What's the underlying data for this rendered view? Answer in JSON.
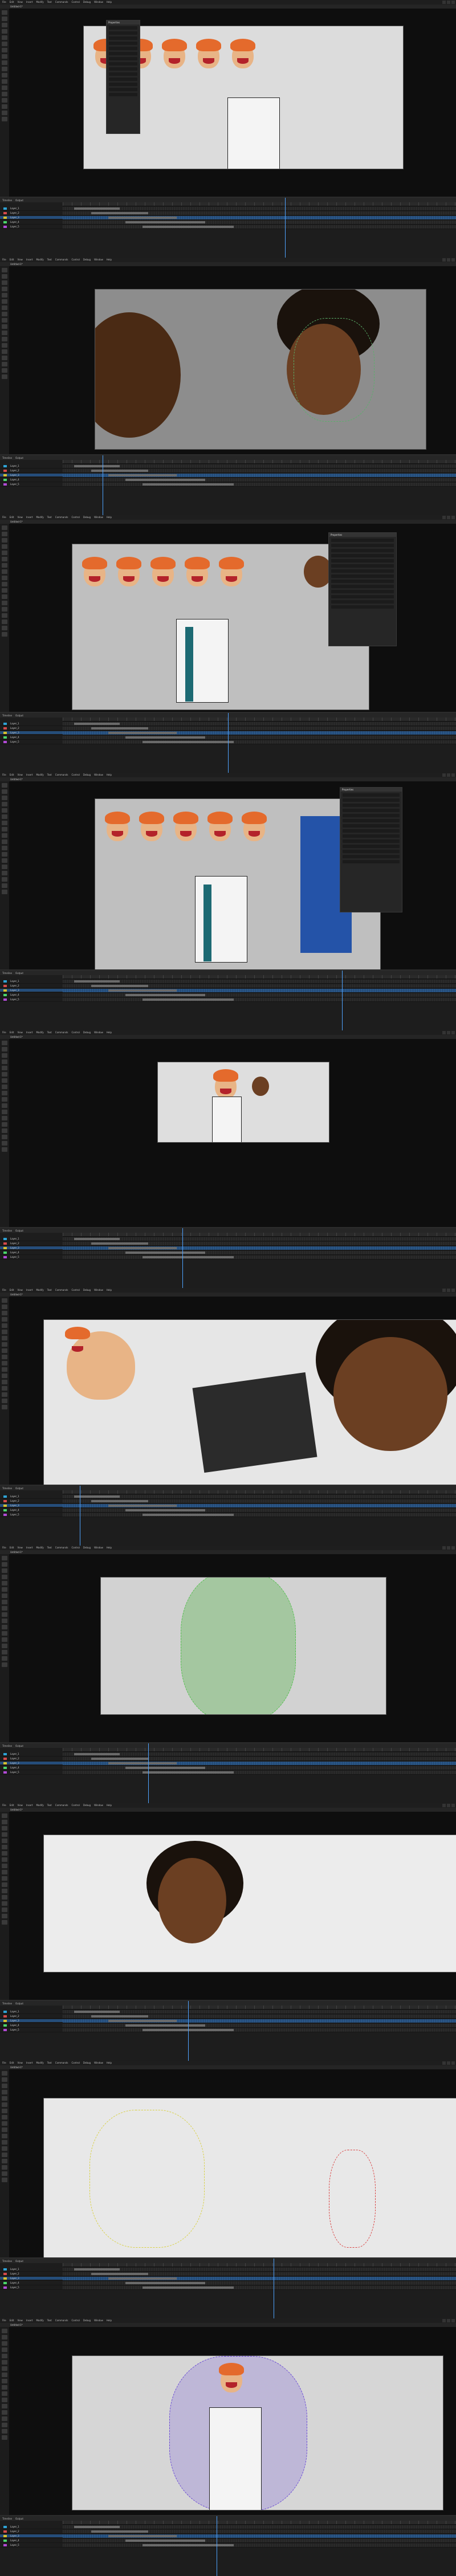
{
  "app": {
    "menu": [
      "File",
      "Edit",
      "View",
      "Insert",
      "Modify",
      "Text",
      "Commands",
      "Control",
      "Debug",
      "Window",
      "Help"
    ],
    "doc_tab": "Untitled-1*"
  },
  "timeline": {
    "tabs": [
      "Timeline",
      "Output"
    ],
    "layers": [
      "Layer_1",
      "Layer_2",
      "Layer_3",
      "Layer_4",
      "Layer_5"
    ]
  },
  "panel": {
    "title": "Properties"
  },
  "frames": [
    {
      "scene": "heads"
    },
    {
      "scene": "closeup"
    },
    {
      "scene": "heads-office"
    },
    {
      "scene": "heads-printer"
    },
    {
      "scene": "standing"
    },
    {
      "scene": "tablet"
    },
    {
      "scene": "motion-blur"
    },
    {
      "scene": "portrait"
    },
    {
      "scene": "sketch"
    },
    {
      "scene": "onion"
    }
  ],
  "colors": {
    "bg": "#121212",
    "timeline_sel": "#254d7a",
    "playhead": "#4fa3ff",
    "hair_orange": "#e46a2c",
    "skin_light": "#e8b486",
    "skin_dark": "#6b3f22",
    "vest_teal": "#1d6a73"
  }
}
